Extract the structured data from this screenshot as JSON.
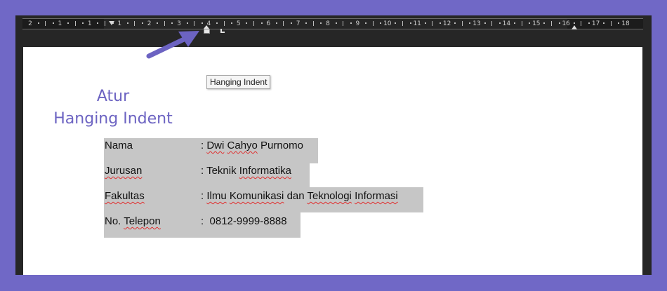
{
  "ruler": {
    "numbers": [
      "2",
      "1",
      "1",
      "1",
      "2",
      "3",
      "4",
      "5",
      "6",
      "7",
      "8",
      "9",
      "10",
      "11",
      "12",
      "13",
      "14",
      "15",
      "16",
      "17",
      "18"
    ]
  },
  "tooltip": {
    "label": "Hanging Indent"
  },
  "annotation": {
    "line1": "Atur",
    "line2": "Hanging Indent"
  },
  "document": {
    "rows": [
      {
        "label": "Nama",
        "sep": ": ",
        "value": "Dwi Cahyo Purnomo"
      },
      {
        "label": "Jurusan",
        "sep": ": ",
        "value": "Teknik Informatika"
      },
      {
        "label": "Fakultas",
        "sep": ": ",
        "value": "Ilmu Komunikasi dan Teknologi Informasi"
      },
      {
        "label": "No. Telepon",
        "sep": ":  ",
        "value": "0812-9999-8888"
      }
    ]
  },
  "colors": {
    "background": "#7068c6",
    "ruler": "#262626",
    "selection": "#c6c6c6",
    "annotation": "#6c63c2",
    "spellcheck": "#e03030"
  }
}
